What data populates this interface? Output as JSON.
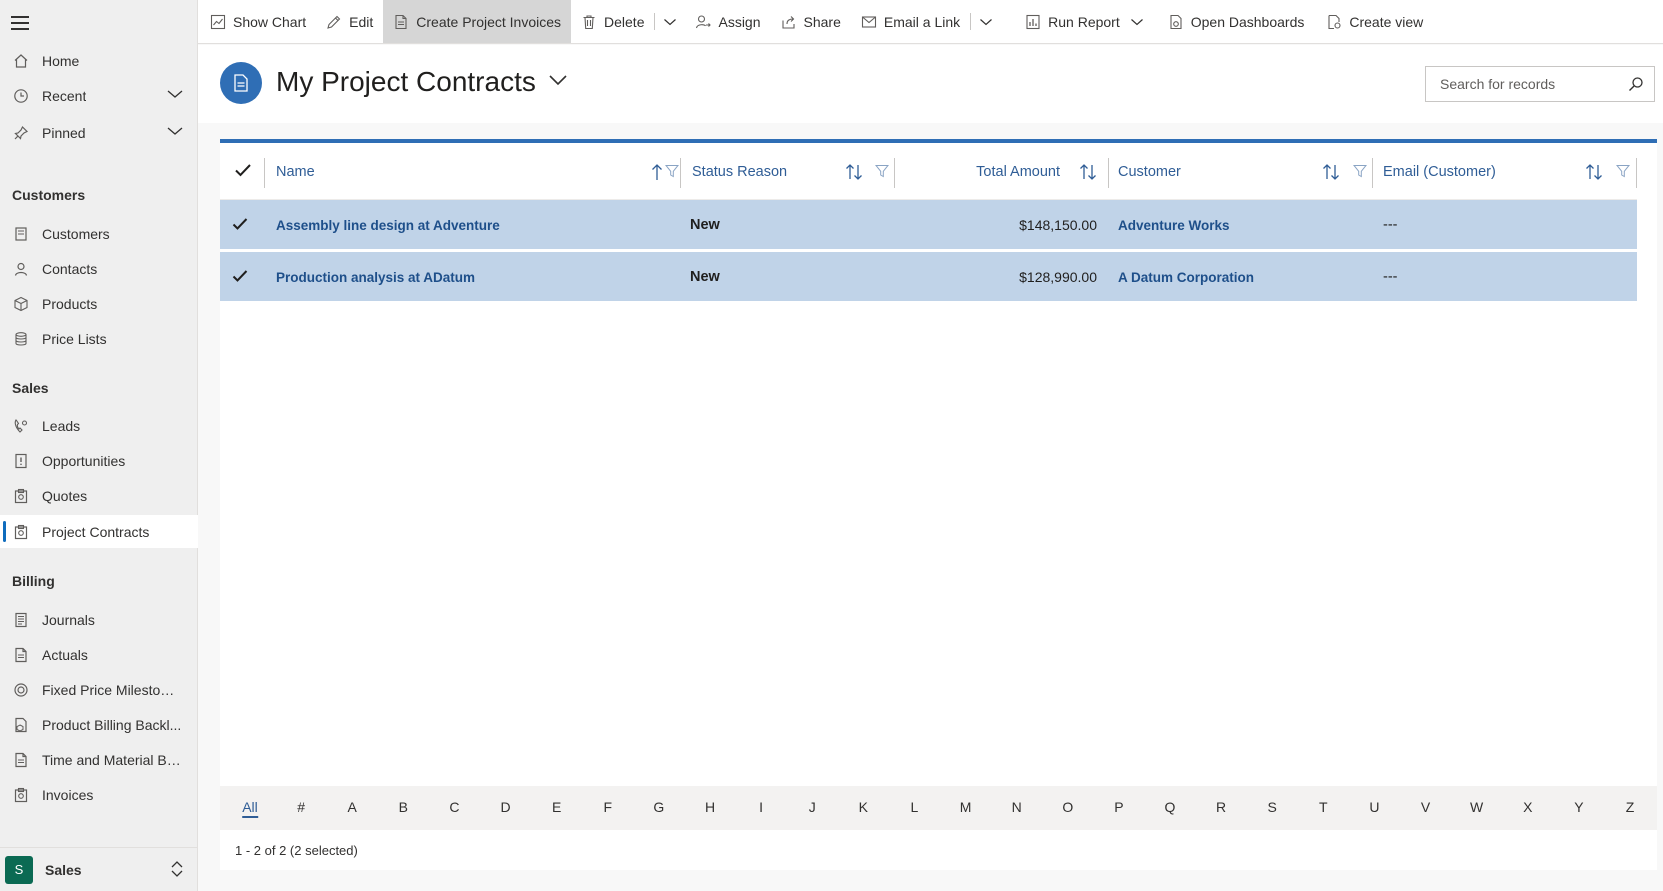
{
  "sidebar": {
    "home": "Home",
    "recent": "Recent",
    "pinned": "Pinned",
    "groups": [
      {
        "title": "Customers",
        "items": [
          "Customers",
          "Contacts",
          "Products",
          "Price Lists"
        ]
      },
      {
        "title": "Sales",
        "items": [
          "Leads",
          "Opportunities",
          "Quotes",
          "Project Contracts"
        ]
      },
      {
        "title": "Billing",
        "items": [
          "Journals",
          "Actuals",
          "Fixed Price Milestones",
          "Product Billing Backl...",
          "Time and Material Bil...",
          "Invoices"
        ]
      }
    ],
    "active_item": "Project Contracts",
    "area": {
      "badge": "S",
      "label": "Sales"
    }
  },
  "commandbar": {
    "show_chart": "Show Chart",
    "edit": "Edit",
    "create_invoices": "Create Project Invoices",
    "delete": "Delete",
    "assign": "Assign",
    "share": "Share",
    "email_link": "Email a Link",
    "run_report": "Run Report",
    "open_dashboards": "Open Dashboards",
    "create_view": "Create view"
  },
  "header": {
    "title": "My Project Contracts",
    "search_placeholder": "Search for records"
  },
  "grid": {
    "columns": {
      "name": "Name",
      "status": "Status Reason",
      "total": "Total Amount",
      "customer": "Customer",
      "email": "Email (Customer)"
    },
    "rows": [
      {
        "name": "Assembly line design at Adventure",
        "status": "New",
        "total": "$148,150.00",
        "customer": "Adventure Works",
        "email": "---"
      },
      {
        "name": "Production analysis at ADatum",
        "status": "New",
        "total": "$128,990.00",
        "customer": "A Datum Corporation",
        "email": "---"
      }
    ],
    "jump_letters": [
      "All",
      "#",
      "A",
      "B",
      "C",
      "D",
      "E",
      "F",
      "G",
      "H",
      "I",
      "J",
      "K",
      "L",
      "M",
      "N",
      "O",
      "P",
      "Q",
      "R",
      "S",
      "T",
      "U",
      "V",
      "W",
      "X",
      "Y",
      "Z"
    ],
    "footer": "1 - 2 of 2 (2 selected)"
  },
  "colors": {
    "accent": "#2f6eb5",
    "row_selected": "#c0d3e8",
    "link": "#1e4f8a"
  }
}
